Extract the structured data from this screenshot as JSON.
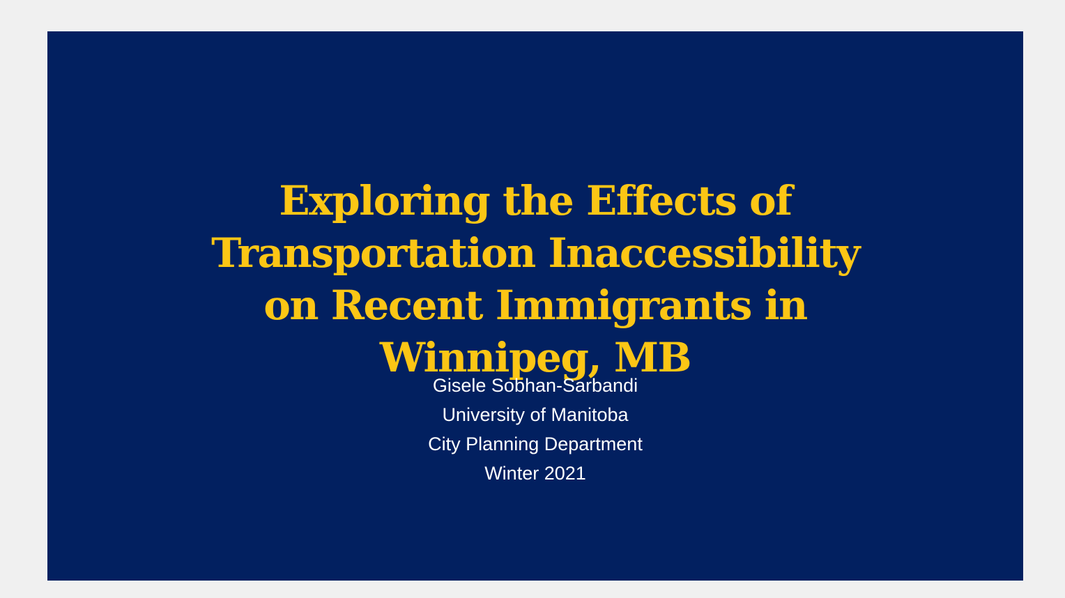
{
  "slide": {
    "background_color": "#022060",
    "title_color": "#fcc615",
    "text_color": "#ffffff",
    "title_lines": [
      "Exploring the Effects of",
      "Transportation Inaccessibility",
      "on Recent Immigrants in",
      "Winnipeg, MB"
    ],
    "author": "Gisele Sobhan-Sarbandi",
    "institution": "University of Manitoba",
    "department": "City Planning Department",
    "term": "Winter 2021"
  }
}
